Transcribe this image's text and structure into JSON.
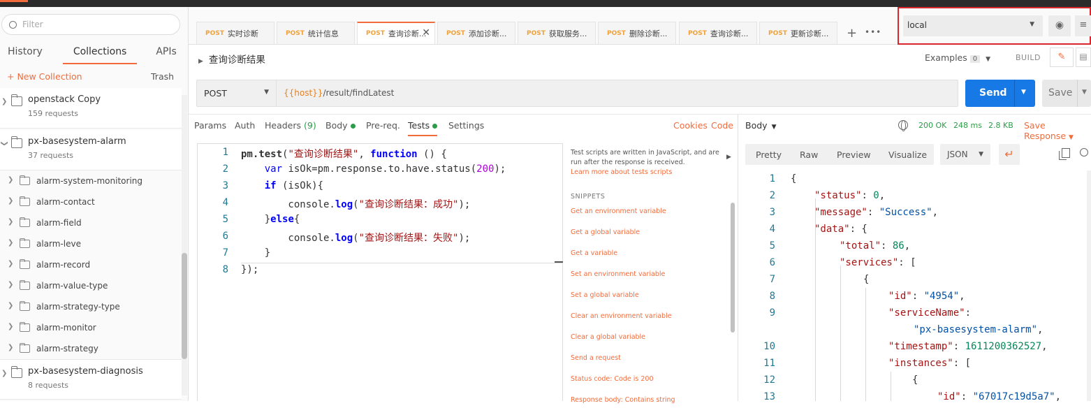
{
  "sidebar": {
    "filter_placeholder": "Filter",
    "tabs": [
      "History",
      "Collections",
      "APIs"
    ],
    "new_collection": "+ New Collection",
    "trash": "Trash",
    "collections": [
      {
        "name": "openstack Copy",
        "sub": "159 requests"
      },
      {
        "name": "px-basesystem-alarm",
        "sub": "37 requests"
      },
      {
        "name": "px-basesystem-diagnosis",
        "sub": "8 requests"
      }
    ],
    "folders": [
      "alarm-system-monitoring",
      "alarm-contact",
      "alarm-field",
      "alarm-leve",
      "alarm-record",
      "alarm-value-type",
      "alarm-strategy-type",
      "alarm-monitor",
      "alarm-strategy"
    ]
  },
  "tabs": [
    {
      "method": "POST",
      "label": "实时诊断"
    },
    {
      "method": "POST",
      "label": "统计信息"
    },
    {
      "method": "POST",
      "label": "查询诊断..."
    },
    {
      "method": "POST",
      "label": "添加诊断..."
    },
    {
      "method": "POST",
      "label": "获取服务..."
    },
    {
      "method": "POST",
      "label": "删除诊断..."
    },
    {
      "method": "POST",
      "label": "查询诊断..."
    },
    {
      "method": "POST",
      "label": "更新诊断..."
    }
  ],
  "env": {
    "selected": "local"
  },
  "request": {
    "title": "查询诊断结果",
    "examples_label": "Examples",
    "examples_count": "0",
    "build": "BUILD",
    "method": "POST",
    "url_var": "{{host}}",
    "url_path": "/result/findLatest",
    "send": "Send",
    "save": "Save"
  },
  "subtabs": {
    "params": "Params",
    "auth": "Auth",
    "headers": "Headers",
    "headers_count": "(9)",
    "body": "Body",
    "prereq": "Pre-req.",
    "tests": "Tests",
    "settings": "Settings",
    "cookies": "Cookies",
    "code": "Code"
  },
  "editor": {
    "line_numbers": [
      "1",
      "2",
      "3",
      "4",
      "5",
      "6",
      "7",
      "8"
    ],
    "l1a": "pm.test",
    "l1b": "(",
    "l1c": "\"查询诊断结果\"",
    "l1d": ", ",
    "l1e": "function",
    "l1f": " () {",
    "l2a": "    var ",
    "l2b": "isOk=pm.response.to.have.status(",
    "l2c": "200",
    "l2d": ");",
    "l3a": "    if",
    "l3b": " (isOk){",
    "l4a": "        console.",
    "l4b": "log",
    "l4c": "(",
    "l4d": "\"查询诊断结果：成功\"",
    "l4e": ");",
    "l5a": "    }",
    "l5b": "else",
    "l5c": "{",
    "l6a": "        console.",
    "l6b": "log",
    "l6c": "(",
    "l6d": "\"查询诊断结果：失败\"",
    "l6e": ");",
    "l7": "    }",
    "l8": "});"
  },
  "snippets": {
    "desc": "Test scripts are written in JavaScript, and are run after the response is received.",
    "learn": "Learn more about tests scripts",
    "head": "SNIPPETS",
    "items": [
      "Get an environment variable",
      "Get a global variable",
      "Get a variable",
      "Set an environment variable",
      "Set a global variable",
      "Clear an environment variable",
      "Clear a global variable",
      "Send a request",
      "Status code: Code is 200",
      "Response body: Contains string"
    ]
  },
  "response": {
    "body_label": "Body",
    "status": "200 OK",
    "time": "248 ms",
    "size": "2.8 KB",
    "save_response": "Save Response",
    "views": [
      "Pretty",
      "Raw",
      "Preview",
      "Visualize"
    ],
    "format": "JSON",
    "line_numbers": [
      "1",
      "2",
      "3",
      "4",
      "5",
      "6",
      "7",
      "8",
      "9",
      "",
      "10",
      "11",
      "12",
      "13"
    ],
    "lines": [
      "{",
      "\"status\": 0,",
      "\"message\": \"Success\",",
      "\"data\": {",
      "\"total\": 86,",
      "\"services\": [",
      "{",
      "\"id\": \"4954\",",
      "\"serviceName\":",
      "\"px-basesystem-alarm\",",
      "\"timestamp\": 1611200362527,",
      "\"instances\": [",
      "{",
      "\"id\": \"67017c19d5a7\","
    ]
  }
}
